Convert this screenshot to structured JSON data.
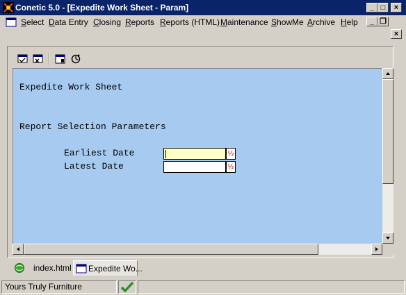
{
  "window": {
    "title": "Conetic 5.0 - [Expedite Work Sheet - Param]",
    "minimize_glyph": "_",
    "maximize_glyph": "□",
    "close_glyph": "×"
  },
  "menubar": {
    "items": [
      {
        "accel": "S",
        "rest": "elect"
      },
      {
        "accel": "D",
        "rest": "ata Entry"
      },
      {
        "accel": "C",
        "rest": "losing"
      },
      {
        "accel": "R",
        "rest": "eports"
      },
      {
        "accel": "R",
        "rest": "eports (HTML)"
      },
      {
        "accel": "M",
        "rest": "aintenance"
      },
      {
        "accel": "S",
        "rest": "howMe"
      },
      {
        "accel": "A",
        "rest": "rchive"
      },
      {
        "accel": "H",
        "rest": "elp"
      }
    ],
    "mdi_minimize_glyph": "_",
    "mdi_restore_glyph": "❐",
    "child_close_glyph": "×"
  },
  "toolbar": {
    "icons": [
      "run-report-icon",
      "cancel-report-icon",
      "preview-icon",
      "refresh-icon"
    ]
  },
  "form": {
    "heading": "Expedite Work Sheet",
    "section": "Report Selection Parameters",
    "earliest_label": "Earliest Date",
    "earliest_value": "",
    "latest_label": "Latest Date",
    "latest_value": "",
    "calendar_glyph": "½"
  },
  "tabs": [
    {
      "label": "index.html",
      "icon": "browser-page-icon"
    },
    {
      "label": "Expedite Wo...",
      "icon": "report-window-icon"
    }
  ],
  "status": {
    "company": "Yours Truly Furniture",
    "indicator": "checkmark-icon"
  },
  "colors": {
    "titlebar": "#0a246a",
    "content_bg": "#a6caf0",
    "active_field": "#ffffc8",
    "check_green": "#2e8b2e"
  }
}
